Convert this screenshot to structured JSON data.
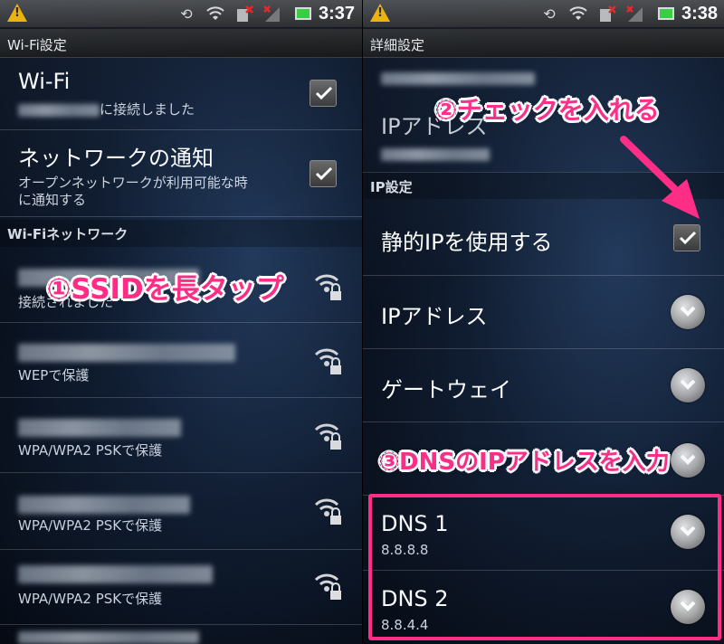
{
  "left": {
    "status_time": "3:37",
    "title": "Wi-Fi設定",
    "wifi_row": {
      "title": "Wi-Fi",
      "subtitle": "に接続しました",
      "checked": true
    },
    "notify_row": {
      "title": "ネットワークの通知",
      "subtitle_line1": "オープンネットワークが利用可能な時",
      "subtitle_line2": "に通知する",
      "checked": true
    },
    "section": "Wi-Fiネットワーク",
    "networks": [
      {
        "subtitle": "接続されました",
        "icon": "wifi-lock-icon"
      },
      {
        "subtitle": "WEPで保護",
        "icon": "wifi-lock-icon"
      },
      {
        "subtitle": "WPA/WPA2 PSKで保護",
        "icon": "wifi-lock-icon"
      },
      {
        "subtitle": "WPA/WPA2 PSKで保護",
        "icon": "wifi-lock-icon"
      },
      {
        "subtitle": "WPA/WPA2 PSKで保護",
        "icon": "wifi-lock-icon"
      }
    ],
    "callout": "①SSIDを長タップ"
  },
  "right": {
    "status_time": "3:38",
    "title": "詳細設定",
    "ip_address_top": "IPアドレス",
    "section": "IP設定",
    "static_ip": {
      "label": "静的IPを使用する",
      "checked": true
    },
    "items": [
      {
        "label": "IPアドレス"
      },
      {
        "label": "ゲートウェイ"
      }
    ],
    "dns": [
      {
        "label": "DNS 1",
        "value": "8.8.8.8"
      },
      {
        "label": "DNS 2",
        "value": "8.8.4.4"
      }
    ],
    "callout_check": "②チェックを入れる",
    "callout_dns": "③DNSのIPアドレスを入力"
  },
  "colors": {
    "accent": "#ff2d86",
    "warning": "#f5b400",
    "battery": "#36d13a"
  },
  "icons": [
    "warning-icon",
    "rotate-icon",
    "wifi-signal-icon",
    "sim-error-icon",
    "cell-signal-icon",
    "battery-icon",
    "checkmark-icon",
    "wifi-lock-icon",
    "chevron-down-icon",
    "arrow-icon"
  ]
}
